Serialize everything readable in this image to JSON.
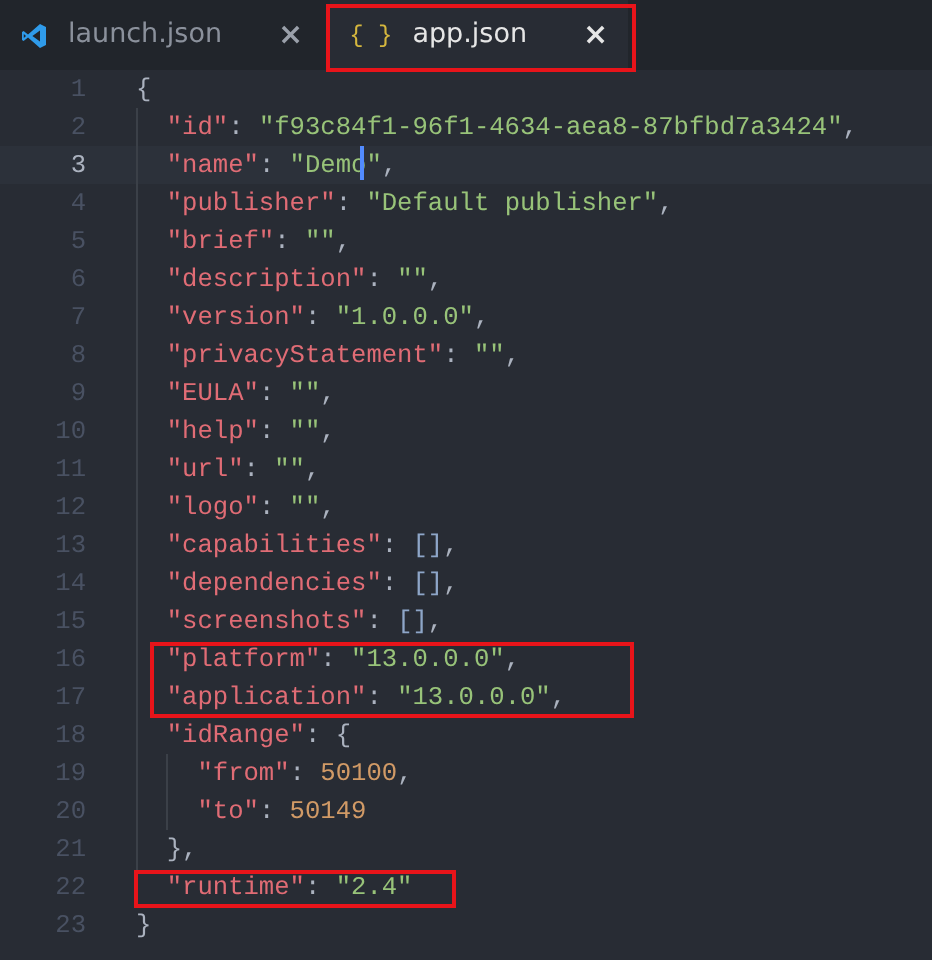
{
  "tabs": [
    {
      "label": "launch.json",
      "selected": false,
      "annotated": false,
      "icon": {
        "kind": "vscode"
      },
      "close": "×"
    },
    {
      "label": "app.json",
      "selected": true,
      "annotated": true,
      "icon": {
        "kind": "glyph",
        "text": "{ }"
      },
      "close": "×"
    }
  ],
  "lines": [
    {
      "number": "1",
      "current": false,
      "boxed": false,
      "tokens": [
        {
          "kind": "brace",
          "text": "{"
        }
      ],
      "children": [
        {
          "number": "2",
          "current": false,
          "boxed": false,
          "tokens": [
            {
              "kind": "key",
              "text": "\"id\""
            },
            {
              "kind": "punct",
              "text": ": "
            },
            {
              "kind": "string",
              "text": "\"f93c84f1-96f1-4634-aea8-87bfbd7a3424\""
            },
            {
              "kind": "punct",
              "text": ","
            }
          ]
        },
        {
          "number": "3",
          "current": true,
          "boxed": false,
          "tokens": [
            {
              "kind": "key",
              "text": "\"name\""
            },
            {
              "kind": "punct",
              "text": ": "
            },
            {
              "kind": "string",
              "text": "\"Demo"
            },
            {
              "kind": "cursor"
            },
            {
              "kind": "string",
              "text": "\""
            },
            {
              "kind": "punct",
              "text": ","
            }
          ]
        },
        {
          "number": "4",
          "current": false,
          "boxed": false,
          "tokens": [
            {
              "kind": "key",
              "text": "\"publisher\""
            },
            {
              "kind": "punct",
              "text": ": "
            },
            {
              "kind": "string",
              "text": "\"Default publisher\""
            },
            {
              "kind": "punct",
              "text": ","
            }
          ]
        },
        {
          "number": "5",
          "current": false,
          "boxed": false,
          "tokens": [
            {
              "kind": "key",
              "text": "\"brief\""
            },
            {
              "kind": "punct",
              "text": ": "
            },
            {
              "kind": "string",
              "text": "\"\""
            },
            {
              "kind": "punct",
              "text": ","
            }
          ]
        },
        {
          "number": "6",
          "current": false,
          "boxed": false,
          "tokens": [
            {
              "kind": "key",
              "text": "\"description\""
            },
            {
              "kind": "punct",
              "text": ": "
            },
            {
              "kind": "string",
              "text": "\"\""
            },
            {
              "kind": "punct",
              "text": ","
            }
          ]
        },
        {
          "number": "7",
          "current": false,
          "boxed": false,
          "tokens": [
            {
              "kind": "key",
              "text": "\"version\""
            },
            {
              "kind": "punct",
              "text": ": "
            },
            {
              "kind": "string",
              "text": "\"1.0.0.0\""
            },
            {
              "kind": "punct",
              "text": ","
            }
          ]
        },
        {
          "number": "8",
          "current": false,
          "boxed": false,
          "tokens": [
            {
              "kind": "key",
              "text": "\"privacyStatement\""
            },
            {
              "kind": "punct",
              "text": ": "
            },
            {
              "kind": "string",
              "text": "\"\""
            },
            {
              "kind": "punct",
              "text": ","
            }
          ]
        },
        {
          "number": "9",
          "current": false,
          "boxed": false,
          "tokens": [
            {
              "kind": "key",
              "text": "\"EULA\""
            },
            {
              "kind": "punct",
              "text": ": "
            },
            {
              "kind": "string",
              "text": "\"\""
            },
            {
              "kind": "punct",
              "text": ","
            }
          ]
        },
        {
          "number": "10",
          "current": false,
          "boxed": false,
          "tokens": [
            {
              "kind": "key",
              "text": "\"help\""
            },
            {
              "kind": "punct",
              "text": ": "
            },
            {
              "kind": "string",
              "text": "\"\""
            },
            {
              "kind": "punct",
              "text": ","
            }
          ]
        },
        {
          "number": "11",
          "current": false,
          "boxed": false,
          "tokens": [
            {
              "kind": "key",
              "text": "\"url\""
            },
            {
              "kind": "punct",
              "text": ": "
            },
            {
              "kind": "string",
              "text": "\"\""
            },
            {
              "kind": "punct",
              "text": ","
            }
          ]
        },
        {
          "number": "12",
          "current": false,
          "boxed": false,
          "tokens": [
            {
              "kind": "key",
              "text": "\"logo\""
            },
            {
              "kind": "punct",
              "text": ": "
            },
            {
              "kind": "string",
              "text": "\"\""
            },
            {
              "kind": "punct",
              "text": ","
            }
          ]
        },
        {
          "number": "13",
          "current": false,
          "boxed": false,
          "tokens": [
            {
              "kind": "key",
              "text": "\"capabilities\""
            },
            {
              "kind": "punct",
              "text": ": "
            },
            {
              "kind": "bracket",
              "text": "[]"
            },
            {
              "kind": "punct",
              "text": ","
            }
          ]
        },
        {
          "number": "14",
          "current": false,
          "boxed": false,
          "tokens": [
            {
              "kind": "key",
              "text": "\"dependencies\""
            },
            {
              "kind": "punct",
              "text": ": "
            },
            {
              "kind": "bracket",
              "text": "[]"
            },
            {
              "kind": "punct",
              "text": ","
            }
          ]
        },
        {
          "number": "15",
          "current": false,
          "boxed": false,
          "tokens": [
            {
              "kind": "key",
              "text": "\"screenshots\""
            },
            {
              "kind": "punct",
              "text": ": "
            },
            {
              "kind": "bracket",
              "text": "[]"
            },
            {
              "kind": "punct",
              "text": ","
            }
          ]
        },
        {
          "number": "16",
          "current": false,
          "boxed": true,
          "tokens": [
            {
              "kind": "key",
              "text": "\"platform\""
            },
            {
              "kind": "punct",
              "text": ": "
            },
            {
              "kind": "string",
              "text": "\"13.0.0.0\""
            },
            {
              "kind": "punct",
              "text": ","
            }
          ]
        },
        {
          "number": "17",
          "current": false,
          "boxed": true,
          "tokens": [
            {
              "kind": "key",
              "text": "\"application\""
            },
            {
              "kind": "punct",
              "text": ": "
            },
            {
              "kind": "string",
              "text": "\"13.0.0.0\""
            },
            {
              "kind": "punct",
              "text": ","
            }
          ]
        },
        {
          "number": "18",
          "current": false,
          "boxed": false,
          "tokens": [
            {
              "kind": "key",
              "text": "\"idRange\""
            },
            {
              "kind": "punct",
              "text": ": "
            },
            {
              "kind": "brace",
              "text": "{"
            }
          ],
          "children": [
            {
              "number": "19",
              "current": false,
              "boxed": false,
              "tokens": [
                {
                  "kind": "key",
                  "text": "\"from\""
                },
                {
                  "kind": "punct",
                  "text": ": "
                },
                {
                  "kind": "number",
                  "text": "50100"
                },
                {
                  "kind": "punct",
                  "text": ","
                }
              ]
            },
            {
              "number": "20",
              "current": false,
              "boxed": false,
              "tokens": [
                {
                  "kind": "key",
                  "text": "\"to\""
                },
                {
                  "kind": "punct",
                  "text": ": "
                },
                {
                  "kind": "number",
                  "text": "50149"
                }
              ]
            }
          ]
        },
        {
          "number": "21",
          "current": false,
          "boxed": false,
          "tokens": [
            {
              "kind": "brace",
              "text": "}"
            },
            {
              "kind": "punct",
              "text": ","
            }
          ]
        },
        {
          "number": "22",
          "current": false,
          "boxed": true,
          "tokens": [
            {
              "kind": "key",
              "text": "\"runtime\""
            },
            {
              "kind": "punct",
              "text": ": "
            },
            {
              "kind": "string",
              "text": "\"2.4\""
            }
          ]
        }
      ]
    },
    {
      "number": "23",
      "current": false,
      "boxed": false,
      "tokens": [
        {
          "kind": "brace",
          "text": "}"
        }
      ]
    }
  ]
}
